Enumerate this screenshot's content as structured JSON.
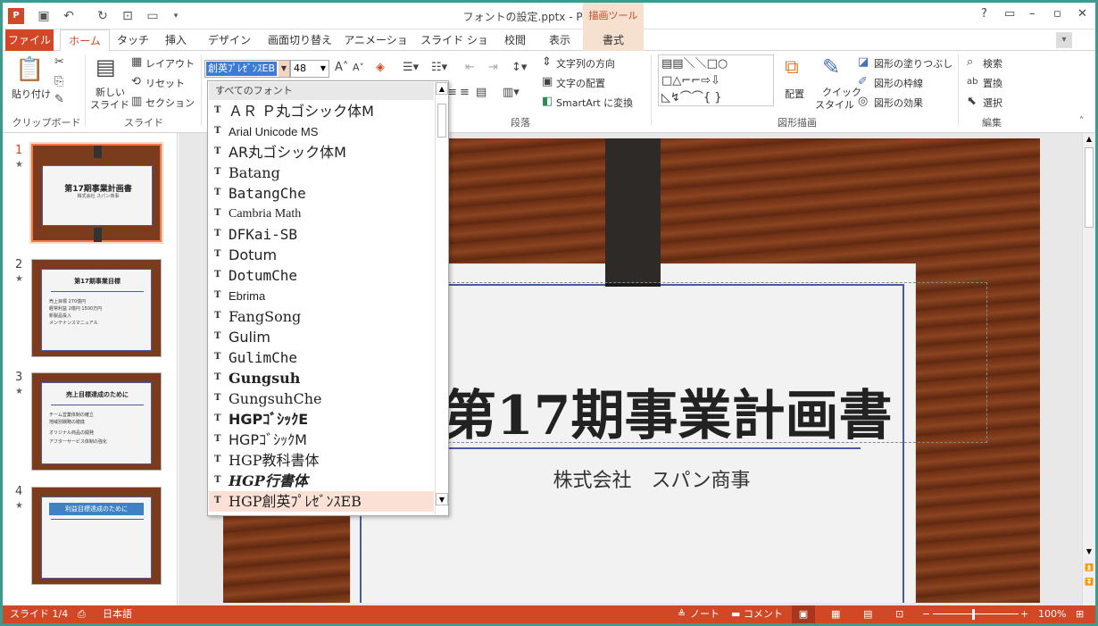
{
  "window": {
    "title": "フォントの設定.pptx - PowerPoint",
    "contextual_group": "描画ツール"
  },
  "title_controls": {
    "help": "?",
    "restore": "▭",
    "minimize": "–",
    "maximize": "▫",
    "close": "✕"
  },
  "tabs": [
    {
      "label": "ファイル"
    },
    {
      "label": "ホーム"
    },
    {
      "label": "タッチ"
    },
    {
      "label": "挿入"
    },
    {
      "label": "デザイン"
    },
    {
      "label": "画面切り替え"
    },
    {
      "label": "アニメーション"
    },
    {
      "label": "スライド ショー"
    },
    {
      "label": "校閲"
    },
    {
      "label": "表示"
    },
    {
      "label": "書式"
    }
  ],
  "ribbon": {
    "clipboard": {
      "paste": "貼り付け",
      "group": "クリップボード"
    },
    "slides": {
      "new_slide_1": "新しい",
      "new_slide_2": "スライド",
      "layout": "レイアウト",
      "reset": "リセット",
      "section": "セクション",
      "group": "スライド"
    },
    "font": {
      "name": "創英ﾌﾟﾚｾﾞﾝｽEB",
      "size": "48"
    },
    "paragraph": {
      "text_direction": "文字列の方向",
      "align_text": "文字の配置",
      "smartart": "SmartArt に変換",
      "group": "段落"
    },
    "drawing": {
      "arrange": "配置",
      "quick_styles_1": "クイック",
      "quick_styles_2": "スタイル",
      "fill": "図形の塗りつぶし",
      "outline": "図形の枠線",
      "effects": "図形の効果",
      "group": "図形描画"
    },
    "editing": {
      "find": "検索",
      "replace": "置換",
      "select": "選択",
      "group": "編集"
    }
  },
  "font_dropdown": {
    "header": "すべてのフォント",
    "items": [
      {
        "label": "ＡＲ Ｐ丸ゴシック体M"
      },
      {
        "label": "Arial Unicode MS"
      },
      {
        "label": "AR丸ゴシック体M"
      },
      {
        "label": "Batang"
      },
      {
        "label": "BatangChe"
      },
      {
        "label": "Cambria Math"
      },
      {
        "label": "DFKai-SB"
      },
      {
        "label": "Dotum"
      },
      {
        "label": "DotumChe"
      },
      {
        "label": "Ebrima"
      },
      {
        "label": "FangSong"
      },
      {
        "label": "Gulim"
      },
      {
        "label": "GulimChe"
      },
      {
        "label": "Gungsuh"
      },
      {
        "label": "GungsuhChe"
      },
      {
        "label": "HGPｺﾞｼｯｸE"
      },
      {
        "label": "HGPｺﾞｼｯｸM"
      },
      {
        "label": "HGP教科書体"
      },
      {
        "label": "HGP行書体"
      },
      {
        "label": "HGP創英ﾌﾟﾚｾﾞﾝｽEB"
      }
    ]
  },
  "thumbnails": [
    {
      "num": "1",
      "title": "第17期事業計画書",
      "subtitle": "株式会社 スパン商事"
    },
    {
      "num": "2",
      "title": "第17期事業目標",
      "bullets": [
        "売上目標 270億円",
        "経常利益 2億円 1500万円",
        "新製品投入",
        "メンテナンスマニュアル"
      ]
    },
    {
      "num": "3",
      "title": "売上目標達成のために",
      "bullets": [
        "チーム営業体制の確立",
        "地域別戦略の徹底",
        "オリジナル商品の開発",
        "アフターサービス体制の強化"
      ]
    },
    {
      "num": "4",
      "title": "利益目標達成のために"
    }
  ],
  "slide": {
    "title": "第17期事業計画書",
    "subtitle": "株式会社　スパン商事"
  },
  "status": {
    "slide": "スライド 1/4",
    "language": "日本語",
    "notes": "ノート",
    "comments": "コメント",
    "zoom": "100%"
  }
}
